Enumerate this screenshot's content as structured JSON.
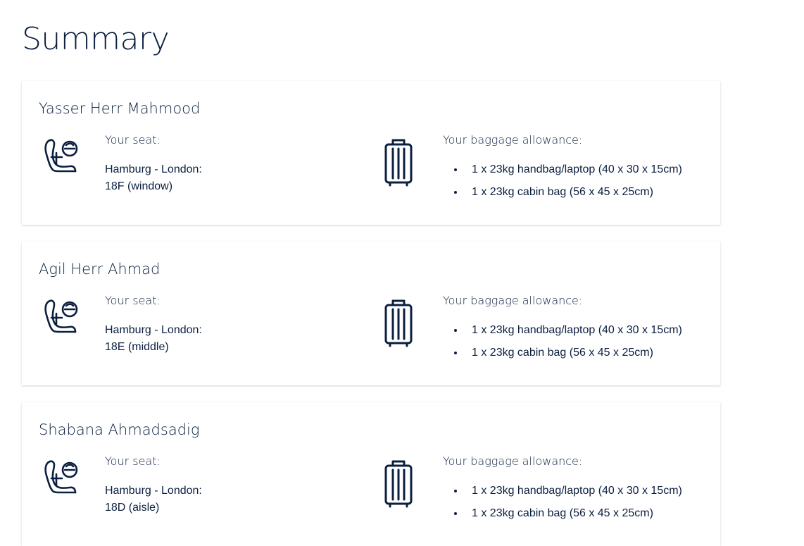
{
  "page": {
    "title": "Summary"
  },
  "passengers": [
    {
      "name": "Yasser Herr Mahmood",
      "seat_heading": "Your seat:",
      "route": "Hamburg - London:",
      "seat": "18F (window)",
      "baggage_heading": "Your baggage allowance:",
      "baggage": [
        "1 x 23kg handbag/laptop (40 x 30 x 15cm)",
        "1 x 23kg cabin bag (56 x 45 x 25cm)"
      ]
    },
    {
      "name": "Agil Herr Ahmad",
      "seat_heading": "Your seat:",
      "route": "Hamburg - London:",
      "seat": "18E (middle)",
      "baggage_heading": "Your baggage allowance:",
      "baggage": [
        "1 x 23kg handbag/laptop (40 x 30 x 15cm)",
        "1 x 23kg cabin bag (56 x 45 x 25cm)"
      ]
    },
    {
      "name": "Shabana Ahmadsadig",
      "seat_heading": "Your seat:",
      "route": "Hamburg - London:",
      "seat": "18D (aisle)",
      "baggage_heading": "Your baggage allowance:",
      "baggage": [
        "1 x 23kg handbag/laptop (40 x 30 x 15cm)",
        "1 x 23kg cabin bag (56 x 45 x 25cm)"
      ]
    }
  ],
  "icons": {
    "seat": "seat-icon",
    "baggage": "suitcase-icon"
  },
  "colors": {
    "text": "#0b1f3f",
    "background": "#ffffff"
  }
}
